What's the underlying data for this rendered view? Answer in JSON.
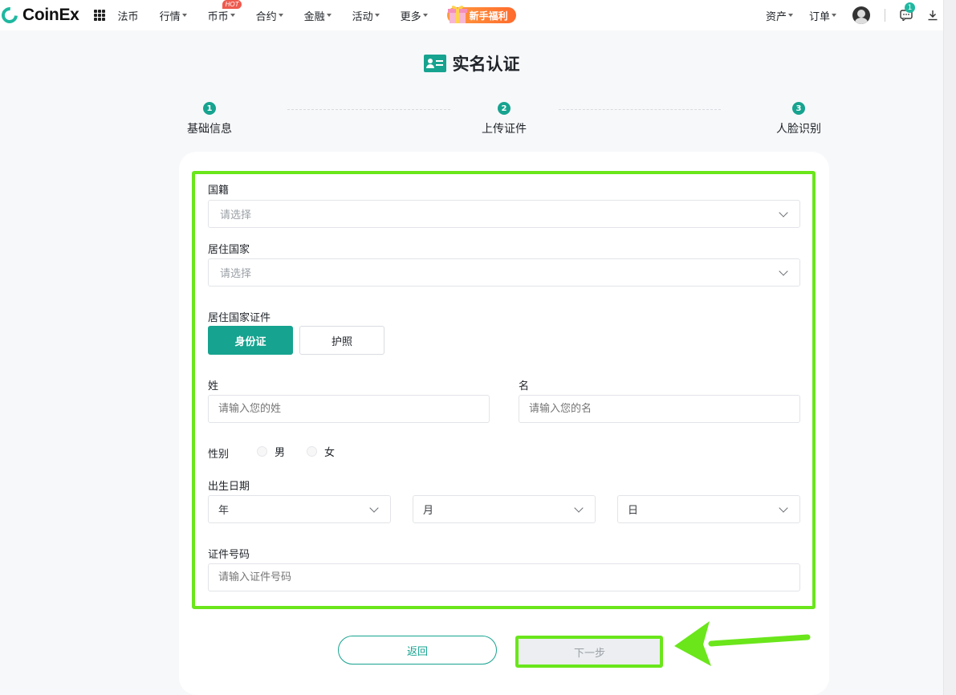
{
  "nav": {
    "brand": "CoinEx",
    "items": [
      {
        "label": "法币",
        "has_caret": false
      },
      {
        "label": "行情",
        "has_caret": true
      },
      {
        "label": "币币",
        "has_caret": true,
        "badge": "HOT"
      },
      {
        "label": "合约",
        "has_caret": true
      },
      {
        "label": "金融",
        "has_caret": true
      },
      {
        "label": "活动",
        "has_caret": true
      },
      {
        "label": "更多",
        "has_caret": true
      }
    ],
    "promo_label": "新手福利",
    "right": {
      "assets": "资产",
      "orders": "订单",
      "message_count": "1"
    },
    "icons": {
      "apps": "apps-grid-icon",
      "gift": "gift-icon",
      "avatar": "avatar-icon",
      "message": "message-icon",
      "download": "download-icon"
    }
  },
  "page": {
    "title": "实名认证",
    "title_icon": "id-card-icon"
  },
  "steps": [
    {
      "number": "1",
      "label": "基础信息"
    },
    {
      "number": "2",
      "label": "上传证件"
    },
    {
      "number": "3",
      "label": "人脸识别"
    }
  ],
  "form": {
    "nationality": {
      "label": "国籍",
      "placeholder": "请选择"
    },
    "residence": {
      "label": "居住国家",
      "placeholder": "请选择"
    },
    "document": {
      "label": "居住国家证件",
      "options": [
        "身份证",
        "护照"
      ],
      "selected": "身份证"
    },
    "surname": {
      "label": "姓",
      "placeholder": "请输入您的姓"
    },
    "given_name": {
      "label": "名",
      "placeholder": "请输入您的名"
    },
    "gender": {
      "label": "性别",
      "options": [
        "男",
        "女"
      ]
    },
    "birthdate": {
      "label": "出生日期",
      "year": "年",
      "month": "月",
      "day": "日"
    },
    "id_number": {
      "label": "证件号码",
      "placeholder": "请输入证件号码"
    }
  },
  "actions": {
    "back": "返回",
    "next": "下一步"
  },
  "colors": {
    "accent": "#16a38f",
    "annotation": "#6ae61b",
    "hot_badge": "#ee5a4f",
    "promo": "#ff7a2f"
  }
}
